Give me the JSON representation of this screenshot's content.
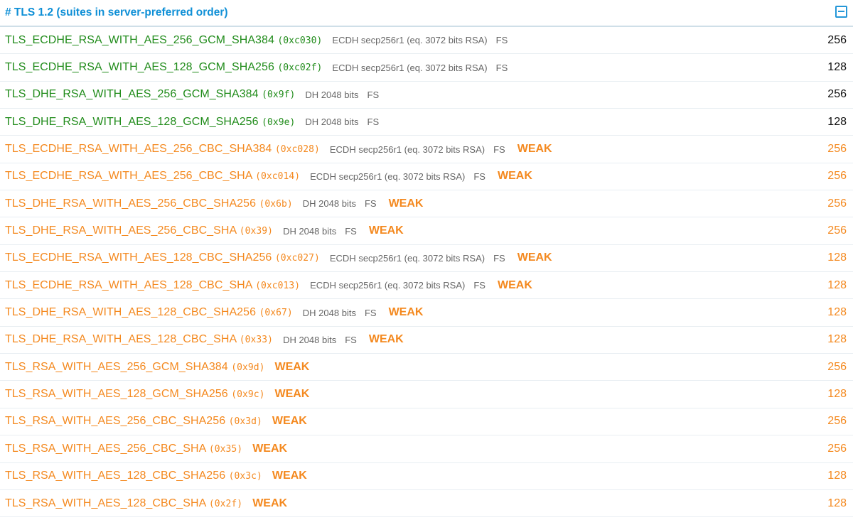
{
  "section": {
    "title": "# TLS 1.2 (suites in server-preferred order)",
    "collapse_icon": "minus-square-icon"
  },
  "colors": {
    "title": "#0e8fd6",
    "secure": "#218c1b",
    "weak": "#f4891f",
    "detail": "#666666"
  },
  "suites": [
    {
      "name": "TLS_ECDHE_RSA_WITH_AES_256_GCM_SHA384",
      "code": "(0xc030)",
      "kex": "ECDH secp256r1 (eq. 3072 bits RSA)",
      "fs": "FS",
      "weak": "",
      "bits": "256",
      "status": "green"
    },
    {
      "name": "TLS_ECDHE_RSA_WITH_AES_128_GCM_SHA256",
      "code": "(0xc02f)",
      "kex": "ECDH secp256r1 (eq. 3072 bits RSA)",
      "fs": "FS",
      "weak": "",
      "bits": "128",
      "status": "green"
    },
    {
      "name": "TLS_DHE_RSA_WITH_AES_256_GCM_SHA384",
      "code": "(0x9f)",
      "kex": "DH 2048 bits",
      "fs": "FS",
      "weak": "",
      "bits": "256",
      "status": "green"
    },
    {
      "name": "TLS_DHE_RSA_WITH_AES_128_GCM_SHA256",
      "code": "(0x9e)",
      "kex": "DH 2048 bits",
      "fs": "FS",
      "weak": "",
      "bits": "128",
      "status": "green"
    },
    {
      "name": "TLS_ECDHE_RSA_WITH_AES_256_CBC_SHA384",
      "code": "(0xc028)",
      "kex": "ECDH secp256r1 (eq. 3072 bits RSA)",
      "fs": "FS",
      "weak": "WEAK",
      "bits": "256",
      "status": "orange"
    },
    {
      "name": "TLS_ECDHE_RSA_WITH_AES_256_CBC_SHA",
      "code": "(0xc014)",
      "kex": "ECDH secp256r1 (eq. 3072 bits RSA)",
      "fs": "FS",
      "weak": "WEAK",
      "bits": "256",
      "status": "orange"
    },
    {
      "name": "TLS_DHE_RSA_WITH_AES_256_CBC_SHA256",
      "code": "(0x6b)",
      "kex": "DH 2048 bits",
      "fs": "FS",
      "weak": "WEAK",
      "bits": "256",
      "status": "orange"
    },
    {
      "name": "TLS_DHE_RSA_WITH_AES_256_CBC_SHA",
      "code": "(0x39)",
      "kex": "DH 2048 bits",
      "fs": "FS",
      "weak": "WEAK",
      "bits": "256",
      "status": "orange"
    },
    {
      "name": "TLS_ECDHE_RSA_WITH_AES_128_CBC_SHA256",
      "code": "(0xc027)",
      "kex": "ECDH secp256r1 (eq. 3072 bits RSA)",
      "fs": "FS",
      "weak": "WEAK",
      "bits": "128",
      "status": "orange"
    },
    {
      "name": "TLS_ECDHE_RSA_WITH_AES_128_CBC_SHA",
      "code": "(0xc013)",
      "kex": "ECDH secp256r1 (eq. 3072 bits RSA)",
      "fs": "FS",
      "weak": "WEAK",
      "bits": "128",
      "status": "orange"
    },
    {
      "name": "TLS_DHE_RSA_WITH_AES_128_CBC_SHA256",
      "code": "(0x67)",
      "kex": "DH 2048 bits",
      "fs": "FS",
      "weak": "WEAK",
      "bits": "128",
      "status": "orange"
    },
    {
      "name": "TLS_DHE_RSA_WITH_AES_128_CBC_SHA",
      "code": "(0x33)",
      "kex": "DH 2048 bits",
      "fs": "FS",
      "weak": "WEAK",
      "bits": "128",
      "status": "orange"
    },
    {
      "name": "TLS_RSA_WITH_AES_256_GCM_SHA384",
      "code": "(0x9d)",
      "kex": "",
      "fs": "",
      "weak": "WEAK",
      "bits": "256",
      "status": "orange"
    },
    {
      "name": "TLS_RSA_WITH_AES_128_GCM_SHA256",
      "code": "(0x9c)",
      "kex": "",
      "fs": "",
      "weak": "WEAK",
      "bits": "128",
      "status": "orange"
    },
    {
      "name": "TLS_RSA_WITH_AES_256_CBC_SHA256",
      "code": "(0x3d)",
      "kex": "",
      "fs": "",
      "weak": "WEAK",
      "bits": "256",
      "status": "orange"
    },
    {
      "name": "TLS_RSA_WITH_AES_256_CBC_SHA",
      "code": "(0x35)",
      "kex": "",
      "fs": "",
      "weak": "WEAK",
      "bits": "256",
      "status": "orange"
    },
    {
      "name": "TLS_RSA_WITH_AES_128_CBC_SHA256",
      "code": "(0x3c)",
      "kex": "",
      "fs": "",
      "weak": "WEAK",
      "bits": "128",
      "status": "orange"
    },
    {
      "name": "TLS_RSA_WITH_AES_128_CBC_SHA",
      "code": "(0x2f)",
      "kex": "",
      "fs": "",
      "weak": "WEAK",
      "bits": "128",
      "status": "orange"
    }
  ]
}
